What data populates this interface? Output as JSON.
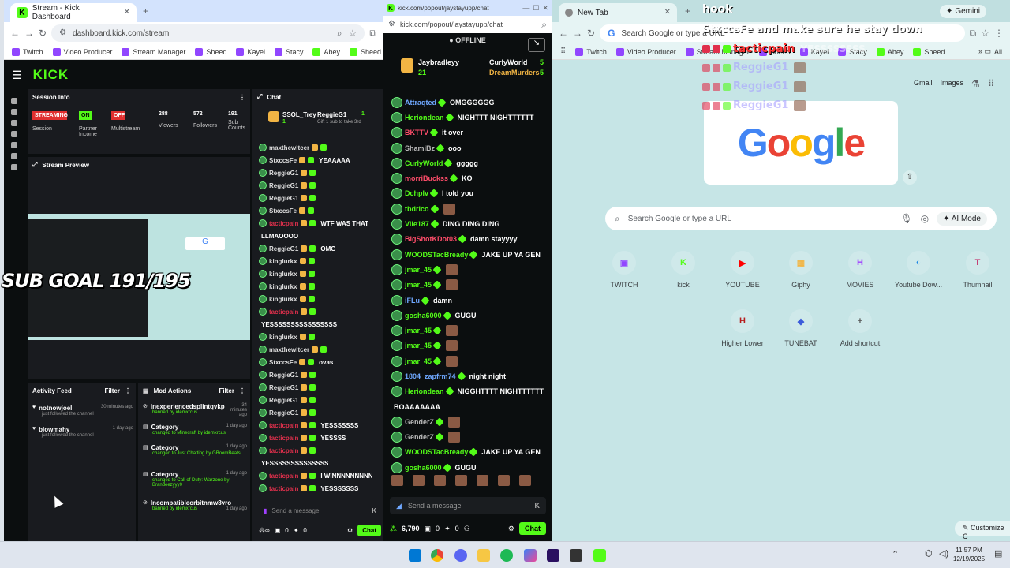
{
  "win1": {
    "tab_title": "Stream - Kick Dashboard",
    "url": "dashboard.kick.com/stream",
    "bookmarks": [
      "Twitch",
      "Video Producer",
      "Stream Manager",
      "Sheed",
      "Kayel",
      "Stacy",
      "Abey",
      "Sheed"
    ]
  },
  "dashboard": {
    "logo": "KICK",
    "session": {
      "title": "Session Info",
      "streaming_badge": "STREAMING",
      "streaming_label": "Session",
      "on_badge": "ON",
      "partner_label": "Partner Income",
      "off_badge": "OFF",
      "multistream_label": "Multistream",
      "stats": [
        {
          "value": "288",
          "label": "Viewers"
        },
        {
          "value": "572",
          "label": "Followers"
        },
        {
          "value": "191",
          "label": "Sub Counts"
        }
      ]
    },
    "preview_title": "Stream Preview",
    "activity": {
      "title": "Activity Feed",
      "filter": "Filter",
      "items": [
        {
          "user": "notnowjoel",
          "action": "just followed the channel",
          "time": "30 minutes ago"
        },
        {
          "user": "blowmahy",
          "action": "just followed the channel",
          "time": "1 day ago"
        }
      ]
    },
    "mod": {
      "title": "Mod Actions",
      "filter": "Filter",
      "items": [
        {
          "title": "inexperiencedsplintqvkp",
          "sub": "banned by idemxrcus",
          "time": "34 minutes ago"
        },
        {
          "title": "Category",
          "sub": "changed to Minecraft by idemxrcus",
          "time": "1 day ago"
        },
        {
          "title": "Category",
          "sub": "changed to Just Chatting by GBoomBeats",
          "time": "1 day ago"
        },
        {
          "title": "Category",
          "sub": "changed to Call of Duty: Warzone by Brandeezyyy0",
          "time": "1 day ago"
        },
        {
          "title": "Incompatibleorbitnmw8vro",
          "sub": "banned by idemxrcus",
          "time": "1 day ago"
        }
      ]
    },
    "chat": {
      "title": "Chat",
      "pinned_user": "SSOL_Trey",
      "pinned_count": "1",
      "gifter": "ReggieG1",
      "gift_note": "Gift 1 sub to take 3rd",
      "gift_count": "1",
      "messages": [
        {
          "user": "maxthewitcer",
          "msg": ""
        },
        {
          "user": "StxccsFe",
          "msg": "YEAAAAA"
        },
        {
          "user": "ReggieG1",
          "msg": ""
        },
        {
          "user": "ReggieG1",
          "msg": ""
        },
        {
          "user": "ReggieG1",
          "msg": ""
        },
        {
          "user": "StxccsFe",
          "msg": ""
        },
        {
          "user": "tacticpain",
          "msg": "WTF WAS THAT"
        },
        {
          "user": "",
          "msg": "LLMAOOOO"
        },
        {
          "user": "ReggieG1",
          "msg": "OMG"
        },
        {
          "user": "kinglurkx",
          "msg": ""
        },
        {
          "user": "kinglurkx",
          "msg": ""
        },
        {
          "user": "kinglurkx",
          "msg": ""
        },
        {
          "user": "kinglurkx",
          "msg": ""
        },
        {
          "user": "tacticpain",
          "msg": ""
        },
        {
          "user": "",
          "msg": "YESSSSSSSSSSSSSSSS"
        },
        {
          "user": "kinglurkx",
          "msg": ""
        },
        {
          "user": "maxthewitcer",
          "msg": ""
        },
        {
          "user": "StxccsFe",
          "msg": "ovas"
        },
        {
          "user": "ReggieG1",
          "msg": ""
        },
        {
          "user": "ReggieG1",
          "msg": ""
        },
        {
          "user": "ReggieG1",
          "msg": ""
        },
        {
          "user": "ReggieG1",
          "msg": ""
        },
        {
          "user": "tacticpain",
          "msg": "YESSSSSSS"
        },
        {
          "user": "tacticpain",
          "msg": "YESSSS"
        },
        {
          "user": "tacticpain",
          "msg": ""
        },
        {
          "user": "",
          "msg": "YESSSSSSSSSSSSSS"
        },
        {
          "user": "tacticpain",
          "msg": "I WINNNNNNNNN"
        },
        {
          "user": "tacticpain",
          "msg": "YESSSSSSS"
        }
      ],
      "placeholder": "Send a message",
      "footer_counts": [
        "0",
        "0"
      ],
      "chat_button": "Chat"
    }
  },
  "win2": {
    "url": "kick.com/popout/jaystayupp/chat",
    "status": "OFFLINE",
    "top1": "Jaybradleyy",
    "top1_count": "21",
    "top2": "CurlyWorld",
    "top2_count": "5",
    "top3": "DreamMurders",
    "top3_count": "5",
    "messages": [
      {
        "user": "Attraqted",
        "msg": "OMGGGGGG",
        "color": "#6fa8ff"
      },
      {
        "user": "Heriondean",
        "msg": "NIGHTTT NIGHTTTTTT",
        "color": "#53fc18"
      },
      {
        "user": "BKTTV",
        "msg": "it over",
        "color": "#ff4d6a"
      },
      {
        "user": "ShamiBz",
        "msg": "ooo",
        "color": "#bbbbbb"
      },
      {
        "user": "CurlyWorld",
        "msg": "ggggg",
        "color": "#53fc18"
      },
      {
        "user": "morriBuckss",
        "msg": "KO",
        "color": "#ff4d6a"
      },
      {
        "user": "Dchplv",
        "msg": "I told you",
        "color": "#53fc18"
      },
      {
        "user": "tbdrico",
        "msg": "",
        "color": "#53fc18"
      },
      {
        "user": "Vile187",
        "msg": "DING DING DING",
        "color": "#53fc18"
      },
      {
        "user": "BigShotKDot03",
        "msg": "damn stayyyy",
        "color": "#ff4d6a"
      },
      {
        "user": "WOODSTacBready",
        "msg": "JAKE UP YA GEN",
        "color": "#53fc18"
      },
      {
        "user": "jmar_45",
        "msg": "",
        "color": "#53fc18"
      },
      {
        "user": "jmar_45",
        "msg": "",
        "color": "#53fc18"
      },
      {
        "user": "iFLu",
        "msg": "damn",
        "color": "#6fa8ff"
      },
      {
        "user": "gosha6000",
        "msg": "GUGU",
        "color": "#53fc18"
      },
      {
        "user": "jmar_45",
        "msg": "",
        "color": "#53fc18"
      },
      {
        "user": "jmar_45",
        "msg": "",
        "color": "#53fc18"
      },
      {
        "user": "jmar_45",
        "msg": "",
        "color": "#53fc18"
      },
      {
        "user": "1804_zapfrm74",
        "msg": "night night",
        "color": "#6fa8ff"
      },
      {
        "user": "Heriondean",
        "msg": "NIGGHTTTT NIGHTTTTTT",
        "color": "#53fc18"
      },
      {
        "user": "",
        "msg": "BOAAAAAAA",
        "color": "#ffffff"
      },
      {
        "user": "GenderZ",
        "msg": "",
        "color": "#bbbbbb"
      },
      {
        "user": "GenderZ",
        "msg": "",
        "color": "#bbbbbb"
      },
      {
        "user": "WOODSTacBready",
        "msg": "JAKE UP YA GEN",
        "color": "#53fc18"
      },
      {
        "user": "gosha6000",
        "msg": "GUGU",
        "color": "#53fc18"
      }
    ],
    "placeholder": "Send a message",
    "viewer_count": "6,790",
    "count_a": "0",
    "count_b": "0",
    "chat_button": "Chat"
  },
  "win3": {
    "tab_title": "New Tab",
    "omni_placeholder": "Search Google or type a URL",
    "gemini": "Gemini",
    "bookmarks": [
      "Twitch",
      "Video Producer",
      "Stream Manager",
      "Sheed",
      "Kayel",
      "Stacy",
      "Abey",
      "Sheed"
    ],
    "bookmark_all": "All",
    "gmail": "Gmail",
    "images": "Images",
    "search_placeholder": "Search Google or type a URL",
    "ai_mode": "AI Mode",
    "shortcuts": [
      "TWITCH",
      "kick",
      "YOUTUBE",
      "Giphy",
      "MOVIES",
      "Youtube Dow...",
      "Thumnail",
      "Higher Lower",
      "TUNEBAT",
      "Add shortcut"
    ],
    "customize": "Customize C"
  },
  "overlay": {
    "sub_goal": "SUB GOAL 191/195",
    "alert_title": "hook",
    "alert_line": "StxccsFe and make sure he stay down",
    "alert_user": "tacticpain",
    "alert_msg": "YESSSSSSSS",
    "alert_users": [
      "ReggieG1",
      "ReggieG1",
      "ReggieG1"
    ]
  },
  "taskbar": {
    "time": "11:57 PM",
    "date": "12/19/2025"
  }
}
